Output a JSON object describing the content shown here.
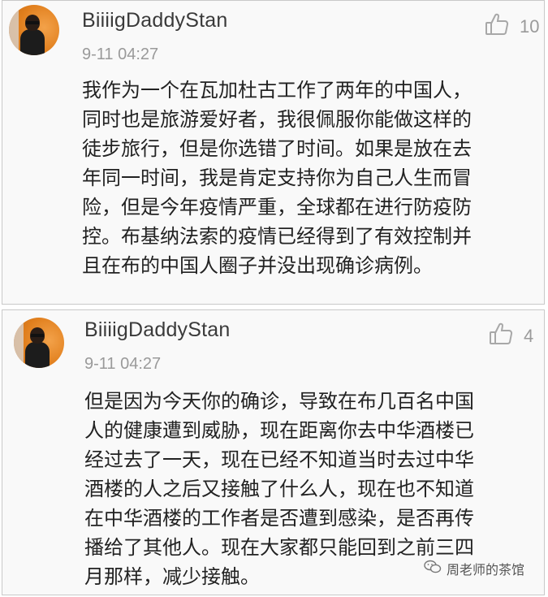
{
  "comments": [
    {
      "username": "BiiiigDaddyStan",
      "time": "9-11 04:27",
      "likes": "10",
      "icon": "thumbs-up-icon",
      "lines": [
        "我作为一个在瓦加杜古工作了两年的中国人，",
        "同时也是旅游爱好者，我很佩服你能做这样的",
        "徒步旅行，但是你选错了时间。如果是放在去",
        "年同一时间，我是肯定支持你为自己人生而冒",
        "险，但是今年疫情严重，全球都在进行防疫防",
        "控。布基纳法索的疫情已经得到了有效控制并",
        "且在布的中国人圈子并没出现确诊病例。"
      ]
    },
    {
      "username": "BiiiigDaddyStan",
      "time": "9-11 04:27",
      "likes": "4",
      "icon": "thumbs-up-icon",
      "lines": [
        "但是因为今天你的确诊，导致在布几百名中国",
        "人的健康遭到威胁，现在距离你去中华酒楼已",
        "经过去了一天，现在已经不知道当时去过中华",
        "酒楼的人之后又接触了什么人，现在也不知道",
        "在中华酒楼的工作者是否遭到感染，是否再传",
        "播给了其他人。现在大家都只能回到之前三四",
        "月那样，减少接触。"
      ]
    }
  ],
  "watermark": {
    "text": "周老师的茶馆",
    "icon": "wechat-icon"
  }
}
